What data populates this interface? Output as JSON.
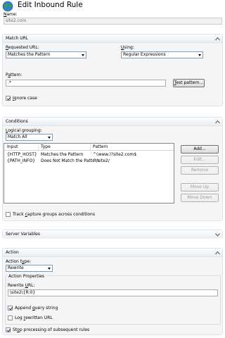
{
  "header": {
    "title": "Edit Inbound Rule",
    "icon": "globe-icon"
  },
  "name": {
    "label": "Name:",
    "value": "site2.com"
  },
  "match_url": {
    "title": "Match URL",
    "requested_url_label": "Requested URL:",
    "requested_url_value": "Matches the Pattern",
    "using_label": "Using:",
    "using_value": "Regular Expressions",
    "pattern_label": "Pattern:",
    "pattern_value": ".*",
    "test_button": "Test pattern...",
    "ignore_case_label": "Ignore case",
    "ignore_case_checked": true
  },
  "conditions": {
    "title": "Conditions",
    "logical_grouping_label": "Logical grouping:",
    "logical_grouping_value": "Match All",
    "columns": [
      "Input",
      "Type",
      "Pattern"
    ],
    "rows": [
      [
        "{HTTP_HOST}",
        "Matches the Pattern",
        "^(www.)?site2.com$"
      ],
      [
        "{PATH_INFO}",
        "Does Not Match the Pattern",
        "^/site2/"
      ]
    ],
    "buttons": {
      "add": "Add...",
      "edit": "Edit...",
      "remove": "Remove",
      "move_up": "Move Up",
      "move_down": "Move Down"
    },
    "track_label": "Track capture groups across conditions",
    "track_checked": false
  },
  "server_variables": {
    "title": "Server Variables"
  },
  "action": {
    "title": "Action",
    "action_type_label": "Action Type:",
    "action_type_value": "Rewrite",
    "properties_title": "Action Properties",
    "rewrite_url_label": "Rewrite URL:",
    "rewrite_url_value": "\\site2\\{R:0}",
    "append_query_label": "Append query string",
    "append_query_checked": true,
    "log_rewritten_label": "Log rewritten URL",
    "log_rewritten_checked": false,
    "stop_processing_label": "Stop processing of subsequent rules",
    "stop_processing_checked": true
  }
}
